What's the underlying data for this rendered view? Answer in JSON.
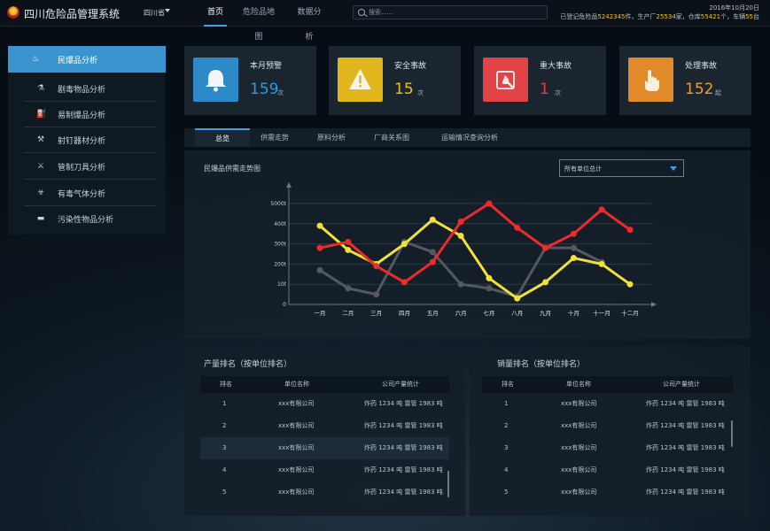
{
  "app": {
    "title": "四川危险品管理系统"
  },
  "region": {
    "label": "四川省"
  },
  "nav": [
    {
      "label": "首页",
      "active": true
    },
    {
      "label": "危险品地图",
      "active": false
    },
    {
      "label": "数据分析",
      "active": false
    }
  ],
  "search": {
    "placeholder": "搜索......",
    "value": ""
  },
  "header_stats": {
    "date": "2016年10月20日",
    "prefix": "已登记危险品",
    "goods_count": "5242345",
    "goods_unit": "件，生产厂",
    "factory_count": "25534",
    "factory_unit": "家，仓库",
    "warehouse_count": "55421",
    "warehouse_unit": "个，车辆",
    "vehicle_count": "55",
    "vehicle_unit": "台"
  },
  "sidebar": {
    "items": [
      {
        "label": "民爆品分析",
        "icon": "rocket-icon",
        "glyph": "♨",
        "active": true
      },
      {
        "label": "剧毒物品分析",
        "icon": "toxic-flask-icon",
        "glyph": "⚗",
        "active": false
      },
      {
        "label": "易制爆品分析",
        "icon": "extinguisher-icon",
        "glyph": "⛽",
        "active": false
      },
      {
        "label": "射钉器材分析",
        "icon": "nail-gun-icon",
        "glyph": "⚒",
        "active": false
      },
      {
        "label": "管制刀具分析",
        "icon": "knife-icon",
        "glyph": "⚔",
        "active": false
      },
      {
        "label": "有毒气体分析",
        "icon": "biohazard-icon",
        "glyph": "☣",
        "active": false
      },
      {
        "label": "污染性物品分析",
        "icon": "battery-icon",
        "glyph": "▬",
        "active": false
      }
    ]
  },
  "cards": [
    {
      "title": "本月预警",
      "value": "159",
      "unit": "次",
      "icon": "bell-icon",
      "color": "#2d8ac8",
      "value_color": "#2d9be0"
    },
    {
      "title": "安全事故",
      "value": "15",
      "unit": "次",
      "icon": "warning-icon",
      "color": "#e1b51c",
      "value_color": "#f0c020"
    },
    {
      "title": "重大事故",
      "value": "1",
      "unit": "次",
      "icon": "fire-alarm-icon",
      "color": "#e24346",
      "value_color": "#ef3b3e"
    },
    {
      "title": "处理事故",
      "value": "152",
      "unit": "起",
      "icon": "hand-pointer-icon",
      "color": "#e08a2a",
      "value_color": "#f09a2c"
    }
  ],
  "tabs": [
    {
      "label": "总览",
      "active": true
    },
    {
      "label": "供需走势",
      "active": false
    },
    {
      "label": "原料分析",
      "active": false
    },
    {
      "label": "厂商关系图",
      "active": false
    },
    {
      "label": "运输情况查询分析",
      "active": false
    }
  ],
  "chart_panel": {
    "title": "民爆品供需走势图"
  },
  "unit_select": {
    "value": "所有单位总计"
  },
  "chart_data": {
    "type": "line",
    "categories": [
      "一月",
      "二月",
      "三月",
      "四月",
      "五月",
      "六月",
      "七月",
      "八月",
      "九月",
      "十月",
      "十一月",
      "十二月"
    ],
    "y_ticks": [
      "0",
      "10t",
      "200t",
      "300t",
      "400t",
      "5000t"
    ],
    "ylim": [
      0,
      5
    ],
    "grid": true,
    "legend": "none",
    "series": [
      {
        "color": "#ee2b2b",
        "values": [
          2.8,
          3.1,
          1.9,
          1.1,
          2.1,
          4.1,
          5.0,
          3.8,
          2.8,
          3.5,
          4.7,
          3.7
        ]
      },
      {
        "color": "#efe03a",
        "values": [
          3.9,
          2.7,
          2.0,
          3.0,
          4.2,
          3.4,
          1.3,
          0.3,
          1.1,
          2.3,
          2.0,
          1.0
        ]
      },
      {
        "color": "#55595f",
        "values": [
          1.7,
          0.8,
          0.5,
          3.1,
          2.6,
          1.0,
          0.8,
          0.4,
          2.8,
          2.8,
          2.1,
          null
        ]
      }
    ]
  },
  "production_ranking": {
    "title": "产量排名（按单位排名）",
    "headers": [
      "排名",
      "单位名称",
      "公司产量统计"
    ],
    "rows": [
      {
        "rank": "1",
        "name": "xxx有限公司",
        "stat": "炸药 1234 吨   雷管 1983 吨"
      },
      {
        "rank": "2",
        "name": "xxx有限公司",
        "stat": "炸药 1234 吨   雷管 1983 吨"
      },
      {
        "rank": "3",
        "name": "xxx有限公司",
        "stat": "炸药 1234 吨   雷管 1983 吨"
      },
      {
        "rank": "4",
        "name": "xxx有限公司",
        "stat": "炸药 1234 吨   雷管 1983 吨"
      },
      {
        "rank": "5",
        "name": "xxx有限公司",
        "stat": "炸药 1234 吨   雷管 1983 吨"
      }
    ]
  },
  "sales_ranking": {
    "title": "销量排名（按单位排名）",
    "headers": [
      "排名",
      "单位名称",
      "公司产量统计"
    ],
    "rows": [
      {
        "rank": "1",
        "name": "xxx有限公司",
        "stat": "炸药 1234 吨   雷管 1983 吨"
      },
      {
        "rank": "2",
        "name": "xxx有限公司",
        "stat": "炸药 1234 吨   雷管 1983 吨"
      },
      {
        "rank": "3",
        "name": "xxx有限公司",
        "stat": "炸药 1234 吨   雷管 1983 吨"
      },
      {
        "rank": "4",
        "name": "xxx有限公司",
        "stat": "炸药 1234 吨   雷管 1983 吨"
      },
      {
        "rank": "5",
        "name": "xxx有限公司",
        "stat": "炸药 1234 吨   雷管 1983 吨"
      }
    ]
  }
}
